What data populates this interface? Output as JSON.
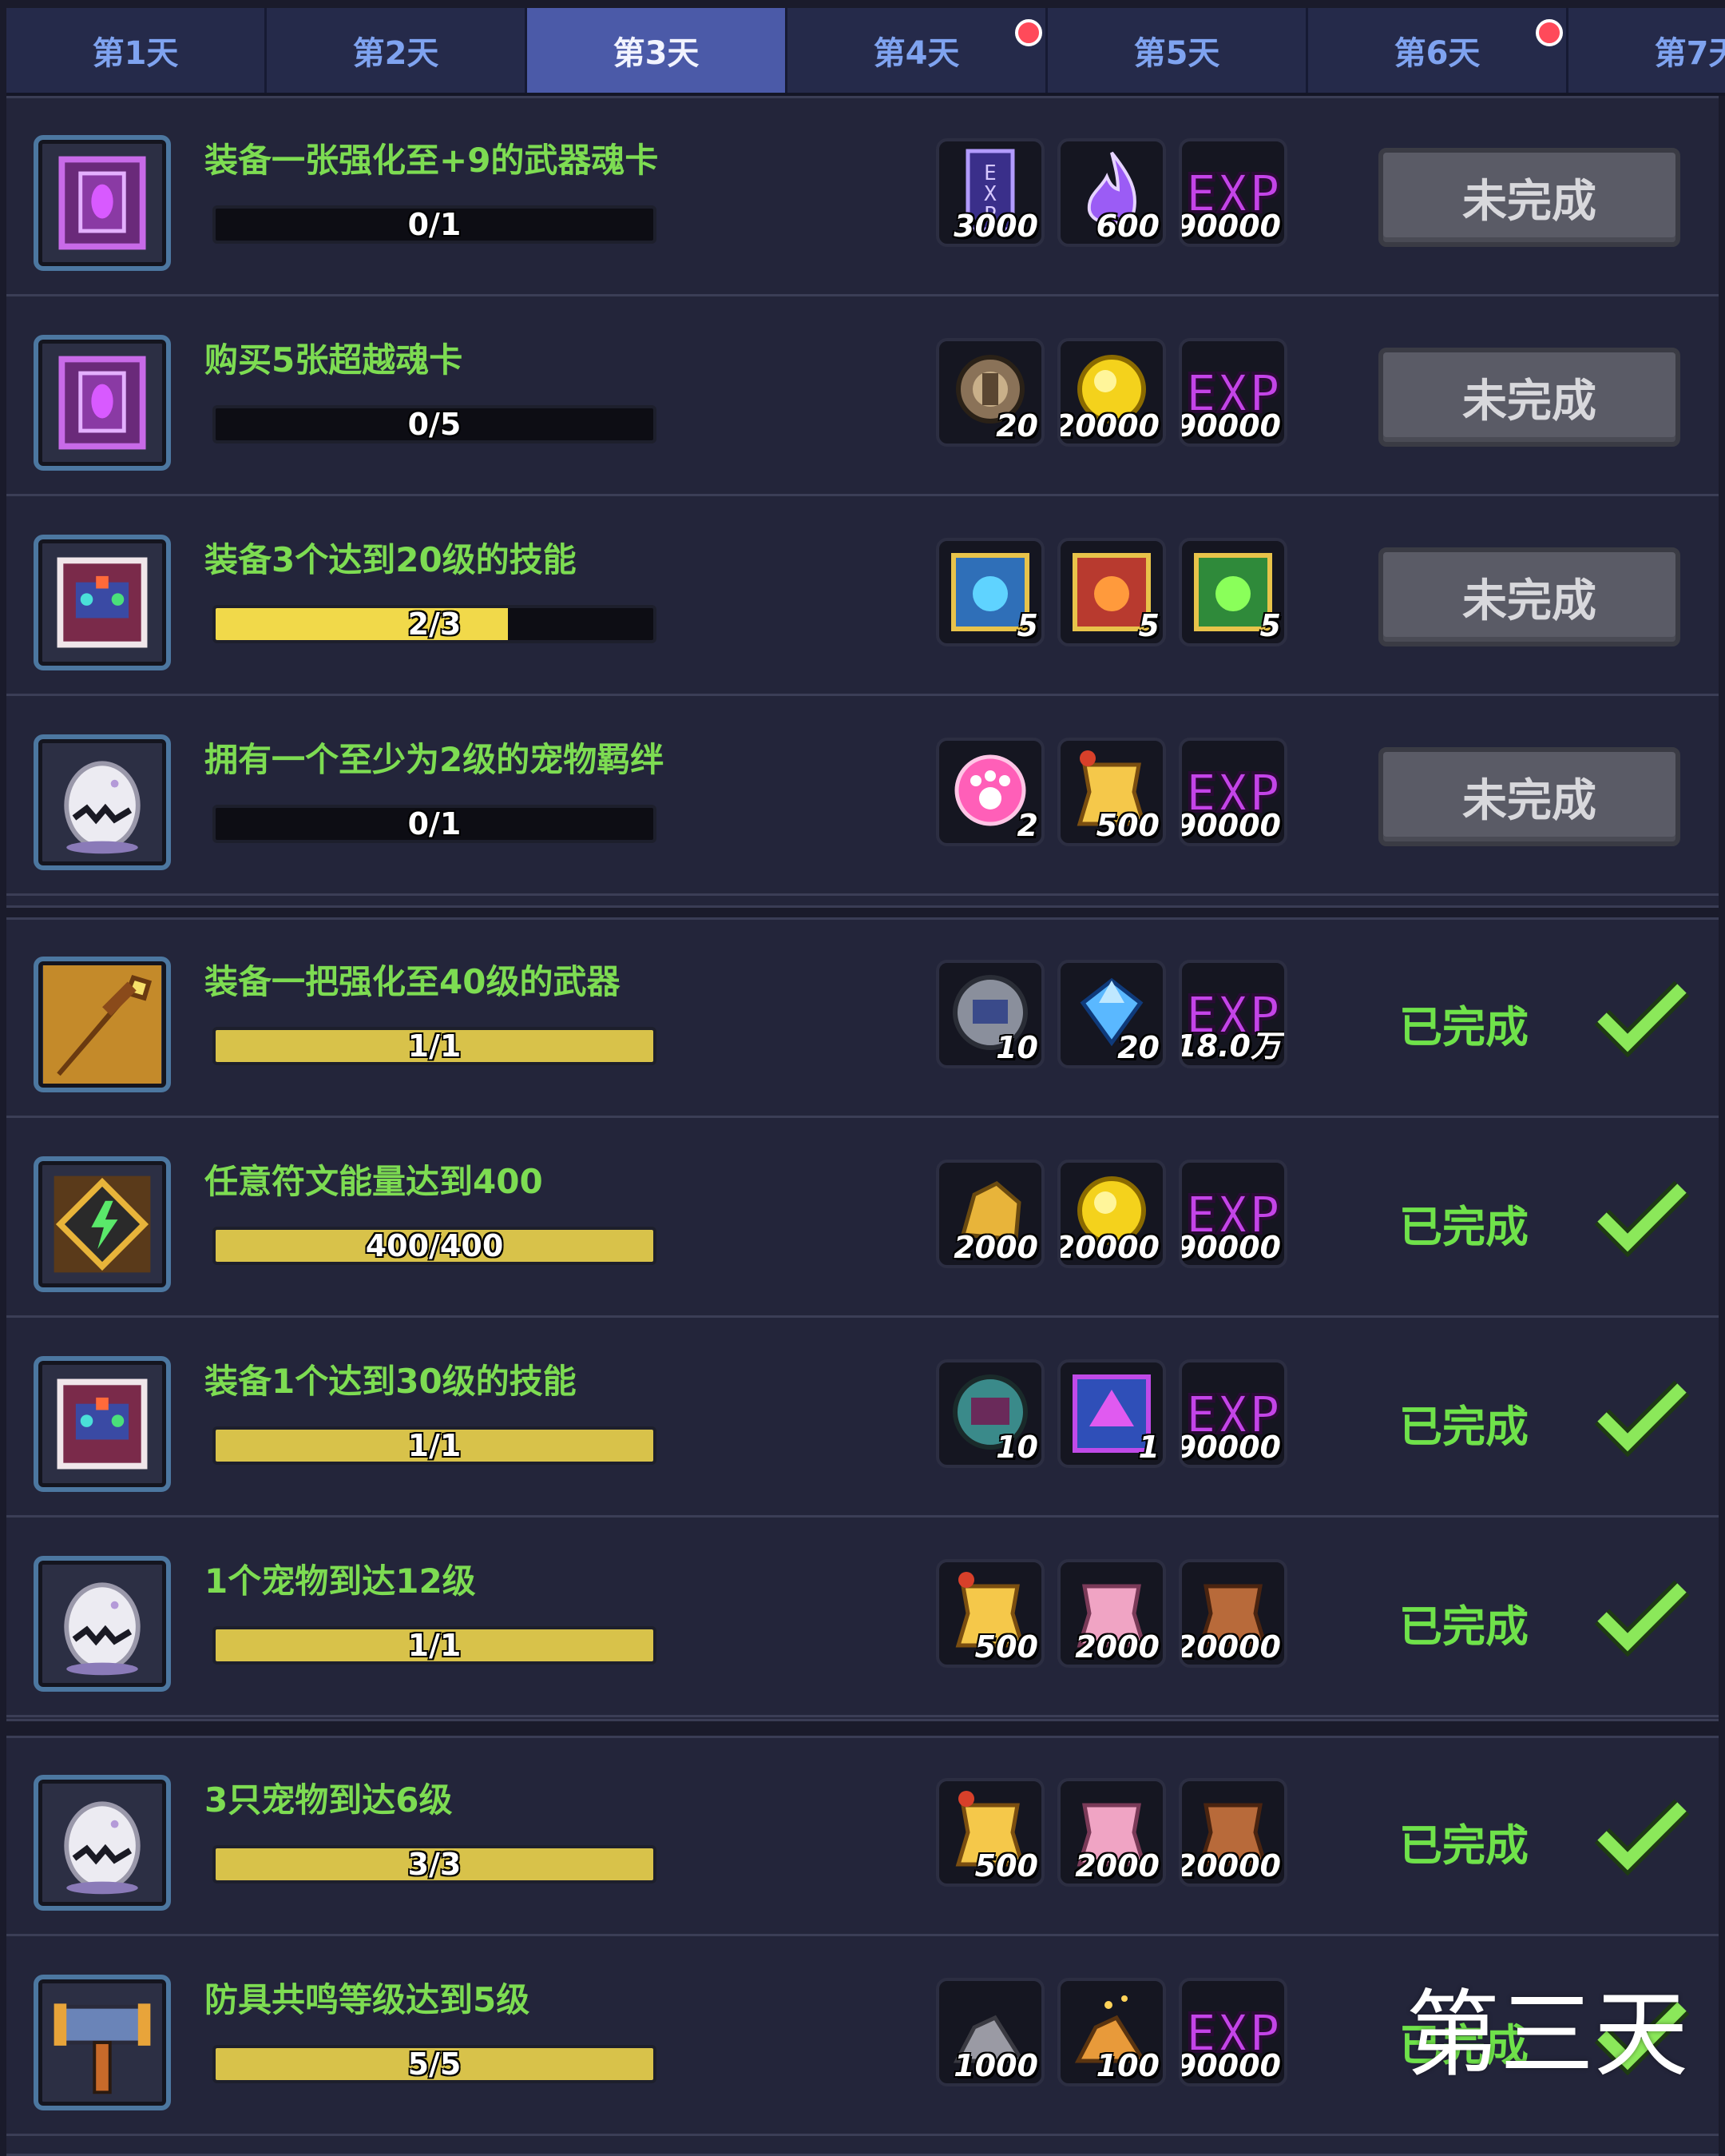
{
  "tabs": [
    {
      "label": "第1天",
      "active": false,
      "badge": false
    },
    {
      "label": "第2天",
      "active": false,
      "badge": false
    },
    {
      "label": "第3天",
      "active": true,
      "badge": false
    },
    {
      "label": "第4天",
      "active": false,
      "badge": true
    },
    {
      "label": "第5天",
      "active": false,
      "badge": false
    },
    {
      "label": "第6天",
      "active": false,
      "badge": true
    },
    {
      "label": "第7天",
      "active": false,
      "badge": false
    }
  ],
  "tasks": [
    {
      "title": "装备一张强化至+9的武器魂卡",
      "progress": "0/1",
      "progress_fraction": 0,
      "icon": "purple-soul-card-icon",
      "rewards": [
        {
          "icon": "exp-book-icon",
          "count": "3000"
        },
        {
          "icon": "purple-flame-icon",
          "count": "600"
        },
        {
          "icon": "exp-icon",
          "count": "90000"
        }
      ],
      "status": "未完成"
    },
    {
      "title": "购买5张超越魂卡",
      "progress": "0/5",
      "progress_fraction": 0,
      "icon": "purple-soul-card-icon",
      "rewards": [
        {
          "icon": "bronze-coin-icon",
          "count": "20"
        },
        {
          "icon": "gold-coin-icon",
          "count": "20000"
        },
        {
          "icon": "exp-icon",
          "count": "90000"
        }
      ],
      "status": "未完成"
    },
    {
      "title": "装备3个达到20级的技能",
      "progress": "2/3",
      "progress_fraction": 0.667,
      "icon": "skill-book-icon",
      "rewards": [
        {
          "icon": "blue-skill-chest-icon",
          "count": "5"
        },
        {
          "icon": "red-skill-chest-icon",
          "count": "5"
        },
        {
          "icon": "green-skill-chest-icon",
          "count": "5"
        }
      ],
      "status": "未完成"
    },
    {
      "title": "拥有一个至少为2级的宠物羁绊",
      "progress": "0/1",
      "progress_fraction": 0,
      "icon": "pet-egg-icon",
      "rewards": [
        {
          "icon": "pink-paw-icon",
          "count": "2"
        },
        {
          "icon": "yellow-pet-food-icon",
          "count": "500"
        },
        {
          "icon": "exp-icon",
          "count": "90000"
        }
      ],
      "status": "未完成"
    },
    {
      "title": "装备一把强化至40级的武器",
      "progress": "1/1",
      "progress_fraction": 1,
      "icon": "golden-sword-icon",
      "rewards": [
        {
          "icon": "robot-token-icon",
          "count": "10"
        },
        {
          "icon": "blue-gem-icon",
          "count": "20"
        },
        {
          "icon": "exp-icon",
          "count": "18.0万"
        }
      ],
      "status": "已完成"
    },
    {
      "title": "任意符文能量达到400",
      "progress": "400/400",
      "progress_fraction": 1,
      "icon": "rune-icon",
      "rewards": [
        {
          "icon": "gold-ore-icon",
          "count": "2000"
        },
        {
          "icon": "gold-coin-icon",
          "count": "20000"
        },
        {
          "icon": "exp-icon",
          "count": "90000"
        }
      ],
      "status": "已完成"
    },
    {
      "title": "装备1个达到30级的技能",
      "progress": "1/1",
      "progress_fraction": 1,
      "icon": "skill-book-icon",
      "rewards": [
        {
          "icon": "skill-token-icon",
          "count": "10"
        },
        {
          "icon": "purple-skill-chest-icon",
          "count": "1"
        },
        {
          "icon": "exp-icon",
          "count": "90000"
        }
      ],
      "status": "已完成"
    },
    {
      "title": "1个宠物到达12级",
      "progress": "1/1",
      "progress_fraction": 1,
      "icon": "pet-egg-icon",
      "rewards": [
        {
          "icon": "yellow-pet-food-icon",
          "count": "500"
        },
        {
          "icon": "pink-pet-food-icon",
          "count": "2000"
        },
        {
          "icon": "brown-pet-food-icon",
          "count": "20000"
        }
      ],
      "status": "已完成"
    },
    {
      "title": "3只宠物到达6级",
      "progress": "3/3",
      "progress_fraction": 1,
      "icon": "pet-egg-icon",
      "rewards": [
        {
          "icon": "yellow-pet-food-icon",
          "count": "500"
        },
        {
          "icon": "pink-pet-food-icon",
          "count": "2000"
        },
        {
          "icon": "brown-pet-food-icon",
          "count": "20000"
        }
      ],
      "status": "已完成"
    },
    {
      "title": "防具共鸣等级达到5级",
      "progress": "5/5",
      "progress_fraction": 1,
      "icon": "hammer-icon",
      "rewards": [
        {
          "icon": "iron-ore-icon",
          "count": "1000"
        },
        {
          "icon": "orange-ore-icon",
          "count": "100"
        },
        {
          "icon": "exp-icon",
          "count": "90000"
        }
      ],
      "status": "已完成"
    }
  ],
  "watermark": "第三天",
  "colors": {
    "tab_active": "#4b5aa8",
    "title_green": "#7ddc52",
    "done_green": "#6fe24a",
    "bar_fill": "#d8c24a",
    "button_gray": "#5a5b66"
  }
}
